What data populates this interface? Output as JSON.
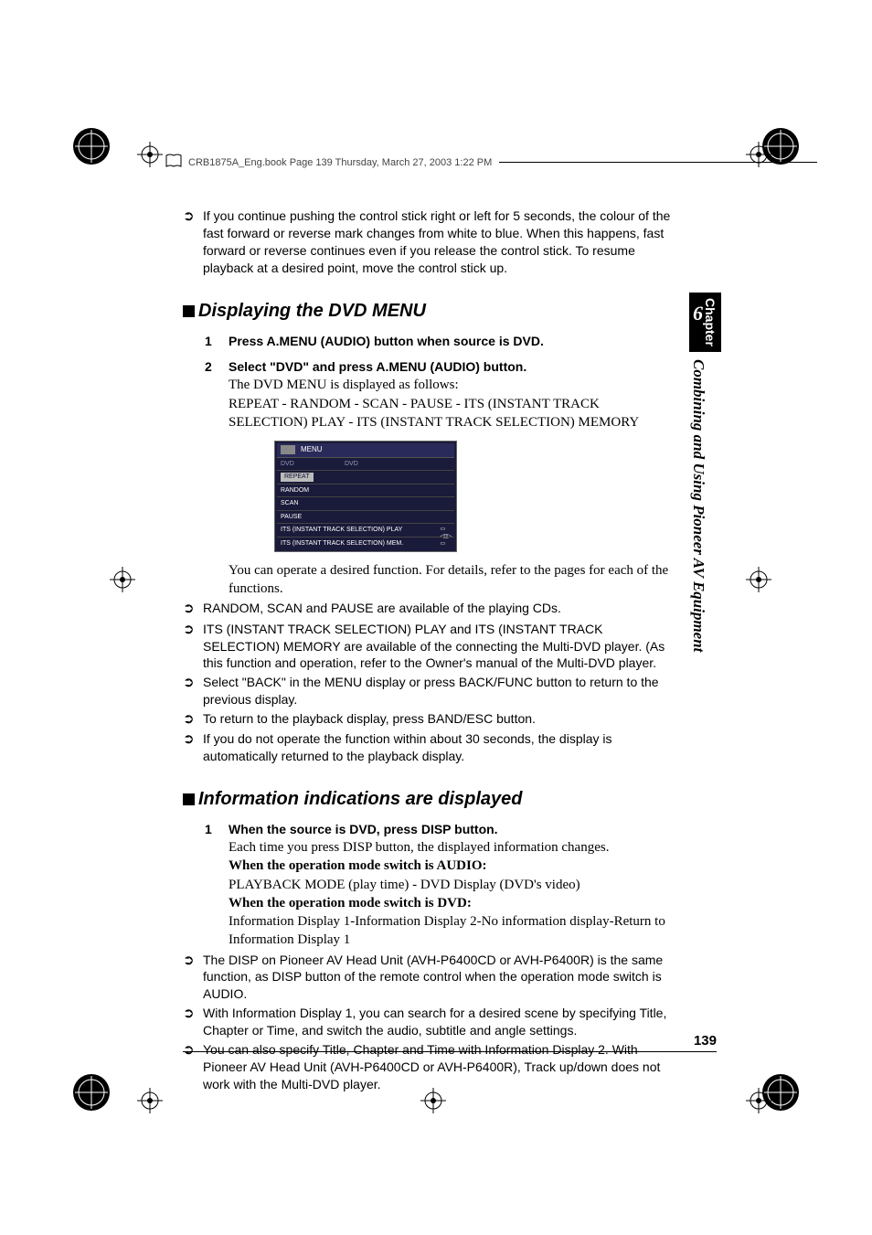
{
  "header": {
    "text": "CRB1875A_Eng.book  Page 139  Thursday, March 27, 2003  1:22 PM"
  },
  "intro_note": "If you continue pushing the control stick right or left for 5 seconds, the colour of the fast forward or reverse mark changes from white to blue. When this happens, fast forward or reverse continues even if you release the control stick. To resume playback at a desired point, move the control stick up.",
  "section1": {
    "title": "Displaying the DVD MENU",
    "step1": {
      "num": "1",
      "bold": "Press A.MENU (AUDIO) button when source is DVD."
    },
    "step2": {
      "num": "2",
      "bold": "Select \"DVD\" and press A.MENU (AUDIO) button.",
      "l1": "The DVD MENU is displayed as follows:",
      "l2": "REPEAT - RANDOM - SCAN - PAUSE - ITS (INSTANT TRACK SELECTION) PLAY - ITS (INSTANT TRACK SELECTION) MEMORY",
      "after": "You can operate a desired function. For details, refer to the pages for each of the functions."
    },
    "menu": {
      "title": "MENU",
      "left": "DVD",
      "right": "DVD",
      "rows": [
        "REPEAT",
        "RANDOM",
        "SCAN",
        "PAUSE",
        "ITS (INSTANT TRACK SELECTION) PLAY",
        "ITS (INSTANT TRACK SELECTION) MEM."
      ]
    },
    "notes": [
      "RANDOM, SCAN and PAUSE are available of the playing CDs.",
      "ITS (INSTANT TRACK SELECTION) PLAY and ITS (INSTANT TRACK SELECTION) MEMORY are available of the connecting the Multi-DVD player. (As this function and operation, refer to the Owner's manual of the Multi-DVD player.",
      "Select \"BACK\" in the MENU display or press BACK/FUNC button to return to the previous display.",
      "To return to the playback display, press BAND/ESC button.",
      "If you do not operate the function within about 30 seconds, the display is automatically returned to the playback display."
    ]
  },
  "section2": {
    "title": "Information indications are displayed",
    "step1": {
      "num": "1",
      "bold": "When the source is DVD, press DISP button.",
      "l1": "Each time you press DISP button, the displayed information changes.",
      "b1": "When the operation mode switch is AUDIO:",
      "l2": "PLAYBACK MODE (play time) - DVD Display (DVD's video)",
      "b2": "When the operation mode switch is DVD:",
      "l3": "Information Display 1-Information Display 2-No information display-Return to Information Display 1"
    },
    "notes": [
      "The DISP on Pioneer AV Head Unit (AVH-P6400CD or AVH-P6400R) is the same function, as DISP button of the remote control when the operation mode switch is AUDIO.",
      "With Information Display 1, you can search for a desired scene by specifying Title, Chapter or Time, and switch the audio, subtitle and angle settings.",
      "You can also specify Title, Chapter and Time with Information Display 2. With Pioneer AV Head Unit (AVH-P6400CD or AVH-P6400R), Track up/down does not work with the Multi-DVD player."
    ]
  },
  "sidebar": {
    "chapter_label": "Chapter",
    "chapter_num": "6",
    "chapter_title": "Combining and Using Pioneer AV Equipment"
  },
  "page_number": "139"
}
